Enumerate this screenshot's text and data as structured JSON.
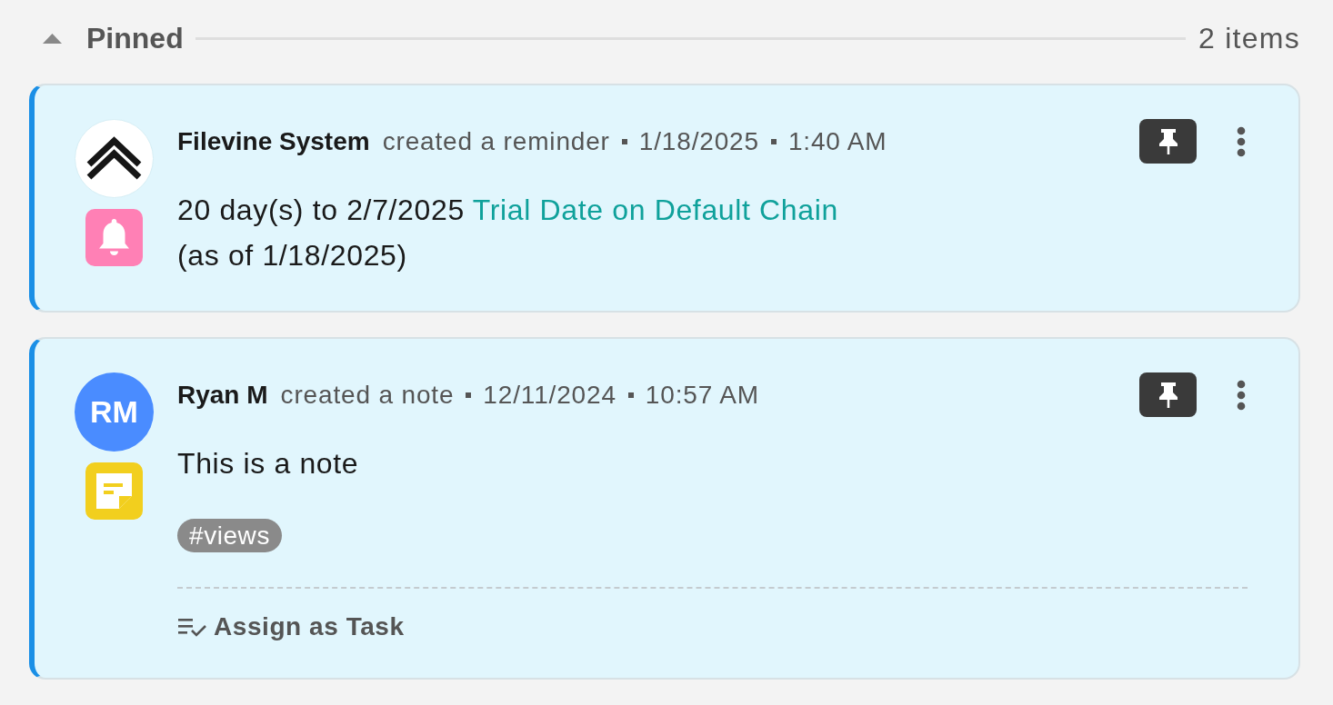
{
  "section": {
    "title": "Pinned",
    "count": "2 items",
    "expanded": true
  },
  "entries": [
    {
      "kind": "reminder",
      "avatar": {
        "kind": "logo"
      },
      "author": "Filevine System",
      "action": "created a reminder",
      "date": "1/18/2025",
      "time": "1:40 AM",
      "pinned": true,
      "body": {
        "text": "20 day(s) to 2/7/2025",
        "link": "Trial Date on Default Chain",
        "note": "(as of 1/18/2025)"
      }
    },
    {
      "kind": "note",
      "avatar": {
        "kind": "initials",
        "initials": "RM"
      },
      "author": "Ryan M",
      "action": "created a note",
      "date": "12/11/2024",
      "time": "10:57 AM",
      "pinned": true,
      "body": {
        "text": "This is a note"
      },
      "tags": [
        "#views"
      ],
      "task_action": "Assign as Task"
    }
  ]
}
